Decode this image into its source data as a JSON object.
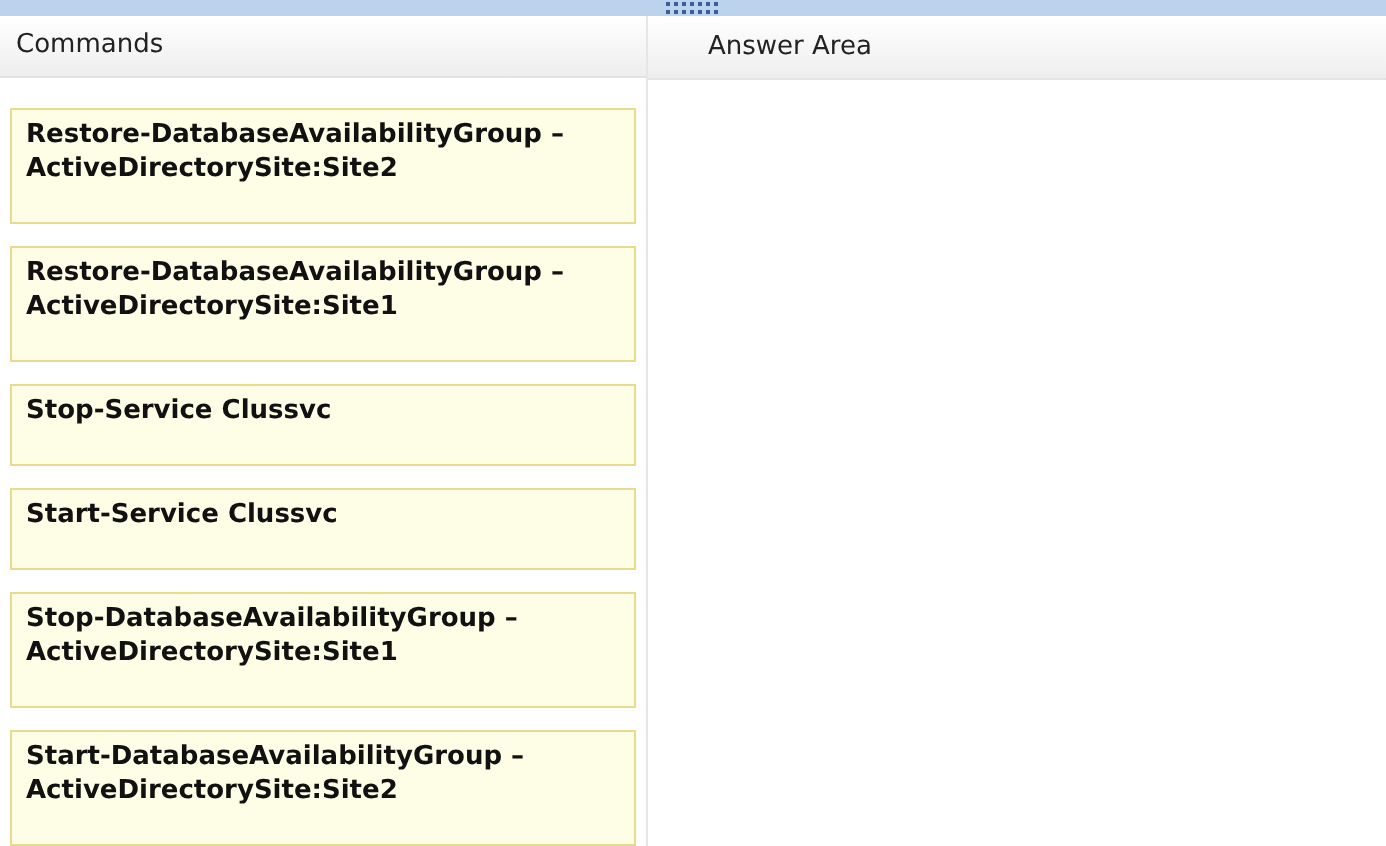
{
  "panels": [
    {
      "title": "Commands"
    },
    {
      "title": "Answer Area"
    }
  ],
  "commands": [
    "Restore-DatabaseAvailabilityGroup – ActiveDirectorySite:Site2",
    "Restore-DatabaseAvailabilityGroup – ActiveDirectorySite:Site1",
    "Stop-Service Clussvc",
    "Start-Service Clussvc",
    "Stop-DatabaseAvailabilityGroup – ActiveDirectorySite:Site1",
    "Start-DatabaseAvailabilityGroup – ActiveDirectorySite:Site2"
  ]
}
